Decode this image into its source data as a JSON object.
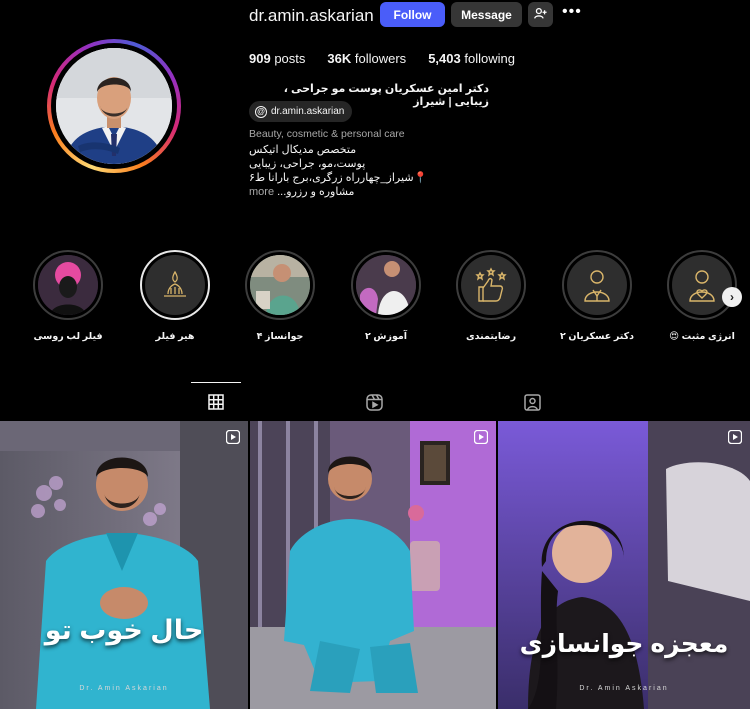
{
  "profile": {
    "username": "dr.amin.askarian",
    "follow_label": "Follow",
    "message_label": "Message",
    "stats": {
      "posts": "909",
      "posts_label": "posts",
      "followers": "36K",
      "followers_label": "followers",
      "following": "5,403",
      "following_label": "following"
    },
    "full_name": "دکتر امین عسکریان پوست مو جراحی ، زیبایی | شیراز",
    "threads_handle": "dr.amin.askarian",
    "category": "Beauty, cosmetic & personal care",
    "bio_lines": [
      "متخصص مدیکال اتیکس",
      "پوست،مو، جراحی، زیبایی",
      "📍شیراز_چهارراه زرگری،برج بارانا ط۶",
      "مشاوره و رزرو..."
    ],
    "bio_more": "more"
  },
  "highlights": [
    {
      "label": "فیلر لب روسی"
    },
    {
      "label": "هیر فیلر"
    },
    {
      "label": "جوانساز ۴"
    },
    {
      "label": "آموزش ۲"
    },
    {
      "label": "رضایتمندی"
    },
    {
      "label": "دکتر عسکریان ۲"
    },
    {
      "label": "انرژی مثبت 😍"
    }
  ],
  "posts": [
    {
      "caption": "حال خوب تو",
      "watermark": "Dr. Amin Askarian"
    },
    {
      "caption": "",
      "watermark": ""
    },
    {
      "caption": "معجزه جوانسازی",
      "watermark": "Dr. Amin Askarian"
    }
  ],
  "colors": {
    "follow_button": "#4a5df9",
    "secondary_button": "#363636",
    "background": "#000000",
    "muted_text": "#a8a8a8"
  },
  "icons": {
    "suggest": "person-plus-icon",
    "more": "ellipsis-icon",
    "threads": "threads-icon",
    "highlights_next": "chevron-right-icon",
    "tab_posts": "grid-icon",
    "tab_reels": "reels-icon",
    "tab_tagged": "tagged-icon",
    "post_type": "reel-play-icon"
  }
}
